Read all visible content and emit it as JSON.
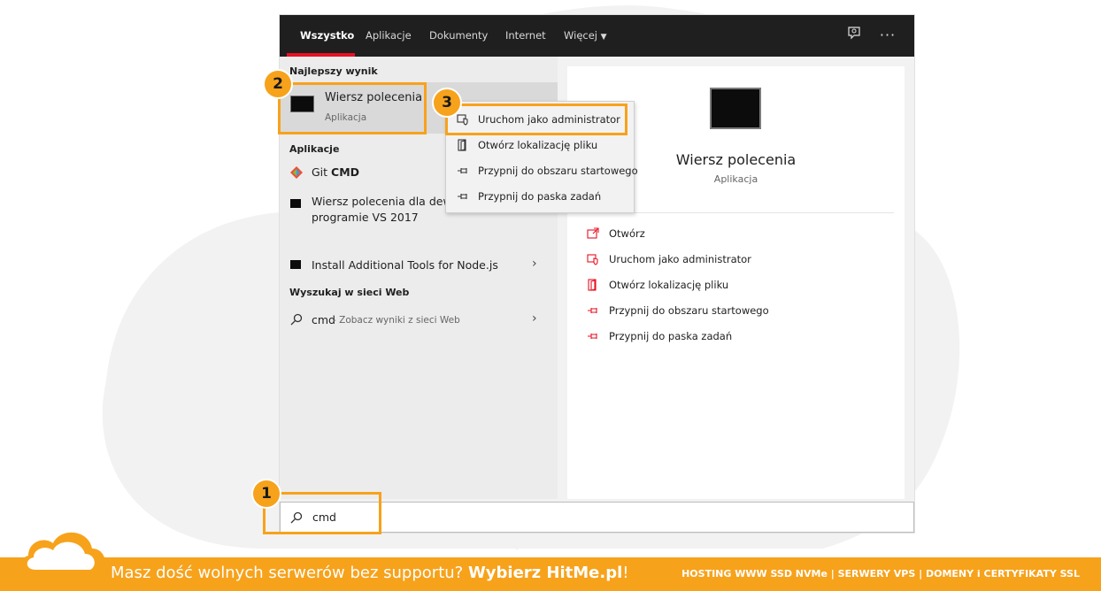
{
  "tabs": [
    {
      "label": "Wszystko",
      "active": true
    },
    {
      "label": "Aplikacje",
      "active": false
    },
    {
      "label": "Dokumenty",
      "active": false
    },
    {
      "label": "Internet",
      "active": false
    },
    {
      "label": "Więcej",
      "active": false
    }
  ],
  "toolbar": {
    "feedback_icon": "feedback-icon",
    "more_glyph": "···"
  },
  "left": {
    "best_match_header": "Najlepszy wynik",
    "best_match": {
      "title": "Wiersz polecenia",
      "subtitle": "Aplikacja"
    },
    "apps_header": "Aplikacje",
    "apps": [
      {
        "prefix": "Git ",
        "bold": "CMD",
        "icon": "git-icon"
      },
      {
        "line1": "Wiersz polecenia dla dew",
        "line2": "programie VS 2017",
        "icon": "cmd-icon"
      },
      {
        "label": "Install Additional Tools for Node.js",
        "icon": "cmd-icon"
      }
    ],
    "web_header": "Wyszukaj w sieci Web",
    "web_result": {
      "query": "cmd",
      "hint": " - Zobacz wyniki z sieci Web"
    }
  },
  "context_menu": [
    {
      "label": "Uruchom jako administrator",
      "icon": "shield-run-icon"
    },
    {
      "label": "Otwórz lokalizację pliku",
      "icon": "folder-open-icon"
    },
    {
      "label": "Przypnij do obszaru startowego",
      "icon": "pin-icon"
    },
    {
      "label": "Przypnij do paska zadań",
      "icon": "pin-icon"
    }
  ],
  "right": {
    "title": "Wiersz polecenia",
    "subtitle": "Aplikacja",
    "actions": [
      {
        "label": "Otwórz",
        "icon": "open-icon"
      },
      {
        "label": "Uruchom jako administrator",
        "icon": "shield-run-icon"
      },
      {
        "label": "Otwórz lokalizację pliku",
        "icon": "folder-open-icon"
      },
      {
        "label": "Przypnij do obszaru startowego",
        "icon": "pin-icon"
      },
      {
        "label": "Przypnij do paska zadań",
        "icon": "pin-icon"
      }
    ]
  },
  "search": {
    "value": "cmd"
  },
  "badges": [
    "1",
    "2",
    "3"
  ],
  "banner": {
    "text": "Masz dość wolnych serwerów bez supportu? ",
    "cta": "Wybierz HitMe.pl",
    "suffix": "!",
    "right": "HOSTING WWW SSD NVMe | SERWERY VPS | DOMENY i CERTYFIKATY SSL"
  },
  "colors": {
    "accent_orange": "#f7a21b",
    "win_accent_red": "#e81123",
    "topbar": "#1f1f1f"
  }
}
